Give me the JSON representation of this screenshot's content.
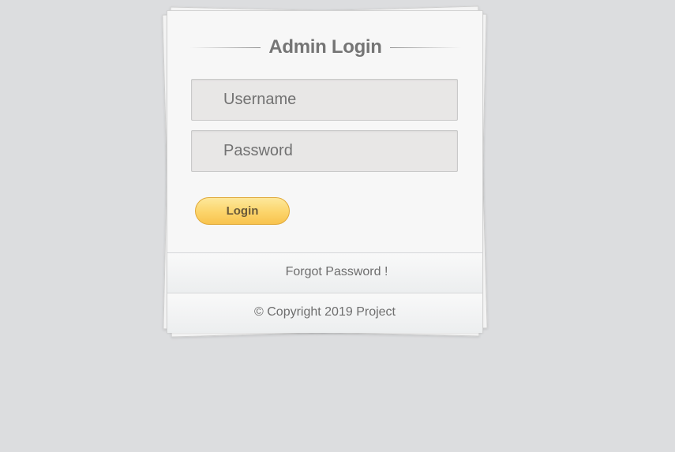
{
  "login": {
    "title": "Admin Login",
    "username_placeholder": "Username",
    "password_placeholder": "Password",
    "button_label": "Login",
    "forgot_label": "Forgot Password !",
    "copyright": "© Copyright 2019 Project"
  },
  "colors": {
    "background": "#dcdddf",
    "button": "#fcd46a",
    "text": "#757575"
  }
}
